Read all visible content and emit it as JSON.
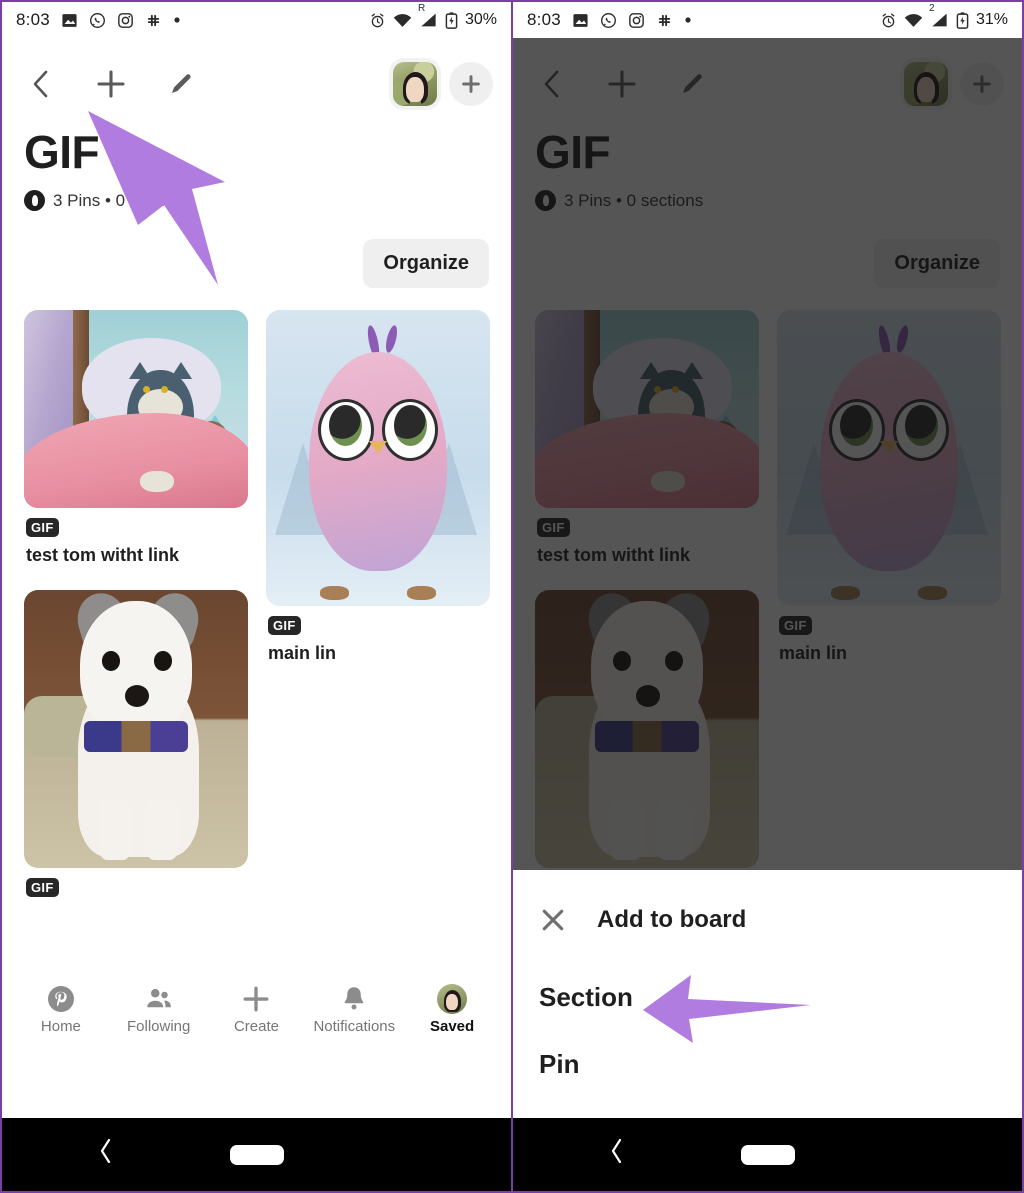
{
  "panels": {
    "left": {
      "statusbar": {
        "time": "8:03",
        "icons": [
          "photos-icon",
          "whatsapp-icon",
          "instagram-icon",
          "slack-icon",
          "dot-icon"
        ],
        "right_icons": [
          "alarm-icon",
          "wifi-icon",
          "signal-icon",
          "battery-icon"
        ],
        "signal_label": "R",
        "battery": "30%"
      },
      "topbar": {
        "back_icon": "chevron-left-icon",
        "add_icon": "plus-icon",
        "edit_icon": "pencil-icon",
        "avatar_label": "profile-avatar",
        "invite_icon": "plus-icon"
      },
      "board": {
        "title": "GIF",
        "privacy_icon": "lock-icon",
        "meta": "3 Pins • 0 sections",
        "organize_label": "Organize"
      },
      "pins": [
        {
          "id": "pin-tom",
          "badge": "GIF",
          "title": "test tom witht link",
          "art": "tom-and-jerry"
        },
        {
          "id": "pin-bird",
          "badge": "GIF",
          "title": "main lin",
          "art": "pink-bird"
        },
        {
          "id": "pin-dog",
          "badge": "GIF",
          "title": "",
          "art": "puppy"
        }
      ],
      "bottomnav": [
        {
          "label": "Home",
          "icon": "pinterest-logo-icon",
          "active": false
        },
        {
          "label": "Following",
          "icon": "people-icon",
          "active": false
        },
        {
          "label": "Create",
          "icon": "plus-icon",
          "active": false
        },
        {
          "label": "Notifications",
          "icon": "bell-icon",
          "active": false
        },
        {
          "label": "Saved",
          "icon": "avatar-icon",
          "active": true
        }
      ],
      "androidnav": {
        "back_icon": "chevron-left-icon",
        "home_pill": "home-pill"
      }
    },
    "right": {
      "statusbar": {
        "time": "8:03",
        "signal_label": "2",
        "battery": "31%"
      },
      "sheet": {
        "close_icon": "close-icon",
        "title": "Add to board",
        "options": [
          {
            "label": "Section"
          },
          {
            "label": "Pin"
          }
        ]
      }
    }
  },
  "annotations": {
    "arrow_color": "#b07ce0",
    "arrow_left_target": "add-icon-in-topbar",
    "arrow_right_target": "section-option"
  },
  "colors": {
    "accent_purple": "#7a3fa6",
    "arrow_purple": "#b07ce0",
    "chip_gray": "#efefef",
    "text_dark": "#1f1f1f",
    "scrim": "rgba(20,20,20,0.72)"
  }
}
